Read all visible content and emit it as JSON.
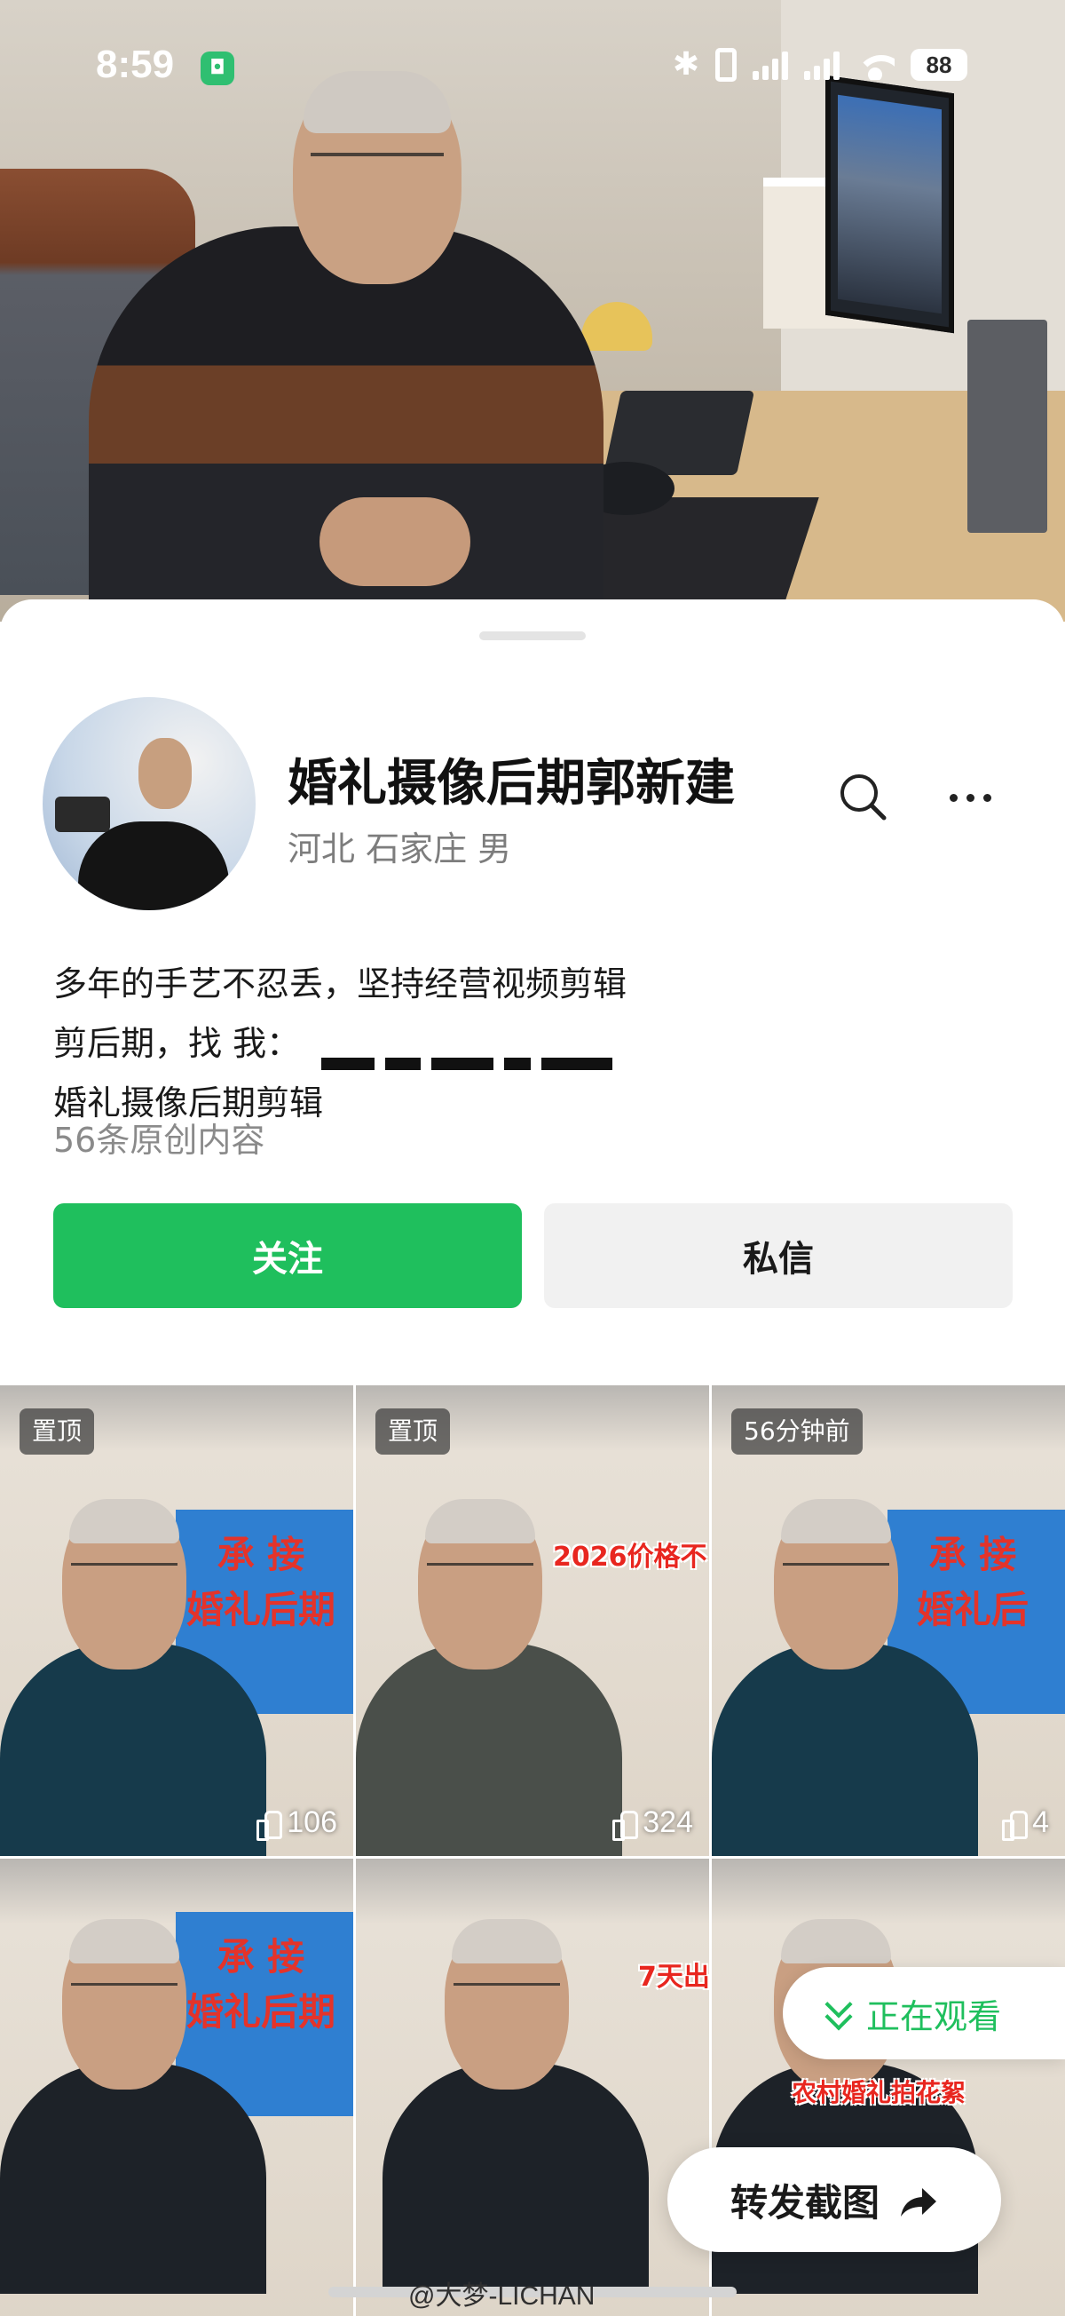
{
  "status_bar": {
    "time": "8:59",
    "battery": "88"
  },
  "profile": {
    "name": "婚礼摄像后期郭新建",
    "region": "河北 石家庄 男",
    "bio_line1": "多年的手艺不忍丢，坚持经营视频剪辑",
    "bio_line2": "剪后期，找 我：",
    "bio_line3": "婚礼摄像后期剪辑",
    "original_count": "56条原创内容"
  },
  "actions": {
    "follow_label": "关注",
    "message_label": "私信"
  },
  "videos": [
    {
      "tag": "置顶",
      "likes": "106",
      "sign_text": "承 接\n婚礼后期",
      "overlay": ""
    },
    {
      "tag": "置顶",
      "likes": "324",
      "sign_text": "",
      "overlay": "2026价格不"
    },
    {
      "tag": "56分钟前",
      "likes": "4",
      "sign_text": "承 接\n婚礼后",
      "overlay": ""
    },
    {
      "tag": "",
      "likes": "",
      "sign_text": "承 接\n婚礼后期",
      "overlay": ""
    },
    {
      "tag": "",
      "likes": "",
      "sign_text": "",
      "overlay": "7天出"
    },
    {
      "tag": "",
      "likes": "",
      "sign_text": "",
      "overlay": "农村婚礼拍花絮"
    }
  ],
  "floating": {
    "watching_label": "正在观看",
    "share_label": "转发截图"
  },
  "watermark": "@大梦-LICHAN",
  "colors": {
    "accent_green": "#1fbf5d",
    "message_bg": "#f1f1f1"
  },
  "icons": [
    "search-icon",
    "more-icon",
    "like-icon",
    "chevron-down-icon",
    "share-arrow-icon",
    "mi-home-icon",
    "bluetooth-icon",
    "vibrate-icon",
    "signal-icon",
    "wifi-icon"
  ]
}
